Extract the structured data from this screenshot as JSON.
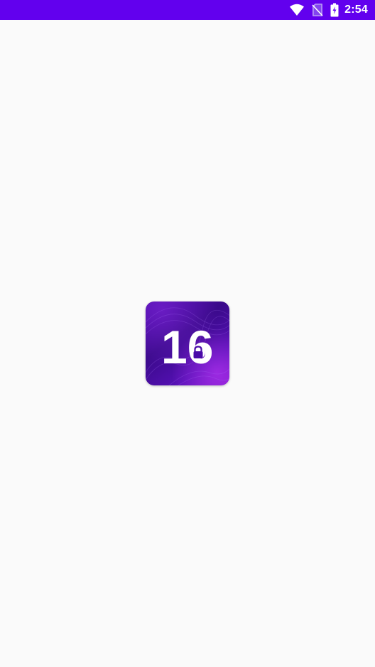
{
  "status_bar": {
    "time": "2:54",
    "background_color": "#6200ee",
    "icons": [
      "wifi-icon",
      "no-sim-icon",
      "battery-charging-icon"
    ]
  },
  "screen": {
    "background_color": "#fafafa"
  },
  "app_icon": {
    "label": "16",
    "badge_icon": "lock-icon",
    "colors": [
      "#3a0a8a",
      "#7a18c8"
    ]
  }
}
